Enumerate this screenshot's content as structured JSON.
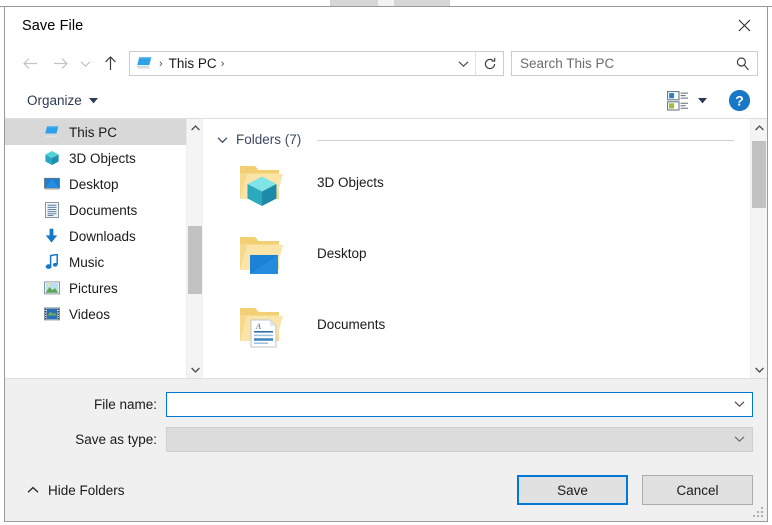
{
  "dialog": {
    "title": "Save File",
    "close_icon": "close-icon"
  },
  "nav_bar": {
    "back_icon": "back-arrow-icon",
    "forward_icon": "forward-arrow-icon",
    "recent_icon": "chevron-down-icon",
    "up_icon": "up-arrow-icon",
    "address": {
      "pc_icon": "this-pc-icon",
      "crumb": "This PC",
      "separator": "›",
      "dropdown_icon": "chevron-down-icon",
      "refresh_icon": "refresh-icon"
    },
    "search": {
      "placeholder": "Search This PC",
      "value": "",
      "icon": "search-icon"
    }
  },
  "command_bar": {
    "organize_label": "Organize",
    "organize_caret_icon": "caret-down-icon",
    "view_options_icon": "view-details-icon",
    "view_caret_icon": "caret-down-icon",
    "help_icon": "help-icon",
    "help_label": "?"
  },
  "nav_pane": {
    "items": [
      {
        "label": "This PC",
        "icon": "this-pc-icon",
        "selected": true
      },
      {
        "label": "3D Objects",
        "icon": "3d-objects-icon",
        "selected": false
      },
      {
        "label": "Desktop",
        "icon": "desktop-icon",
        "selected": false
      },
      {
        "label": "Documents",
        "icon": "documents-icon",
        "selected": false
      },
      {
        "label": "Downloads",
        "icon": "downloads-icon",
        "selected": false
      },
      {
        "label": "Music",
        "icon": "music-icon",
        "selected": false
      },
      {
        "label": "Pictures",
        "icon": "pictures-icon",
        "selected": false
      },
      {
        "label": "Videos",
        "icon": "videos-icon",
        "selected": false
      }
    ],
    "scrollbar": {
      "up_icon": "scroll-up-icon",
      "down_icon": "scroll-down-icon",
      "thumb_top_pct": 40,
      "thumb_height_pct": 30
    }
  },
  "content_pane": {
    "group_header": "Folders (7)",
    "group_collapse_icon": "chevron-down-icon",
    "folders": [
      {
        "label": "3D Objects",
        "icon": "folder-3d-objects-icon"
      },
      {
        "label": "Desktop",
        "icon": "folder-desktop-icon"
      },
      {
        "label": "Documents",
        "icon": "folder-documents-icon"
      }
    ],
    "scrollbar": {
      "up_icon": "scroll-up-icon",
      "down_icon": "scroll-down-icon",
      "thumb_top_pct": 2,
      "thumb_height_pct": 30
    }
  },
  "form": {
    "filename": {
      "label": "File name:",
      "value": "",
      "placeholder": "",
      "dropdown_icon": "chevron-down-icon"
    },
    "filetype": {
      "label": "Save as type:",
      "value": "",
      "placeholder": "",
      "dropdown_icon": "chevron-down-icon"
    }
  },
  "footer": {
    "hide_folders_label": "Hide Folders",
    "hide_folders_icon": "chevron-up-icon",
    "save_label": "Save",
    "cancel_label": "Cancel",
    "resize_grip_icon": "resize-grip-icon"
  },
  "colors": {
    "accent": "#0078d7",
    "dialog_bg": "#f0f0f0",
    "selection": "#d8d8d8",
    "folder_yellow": "#f5d68a",
    "group_header": "#3b4a63"
  }
}
